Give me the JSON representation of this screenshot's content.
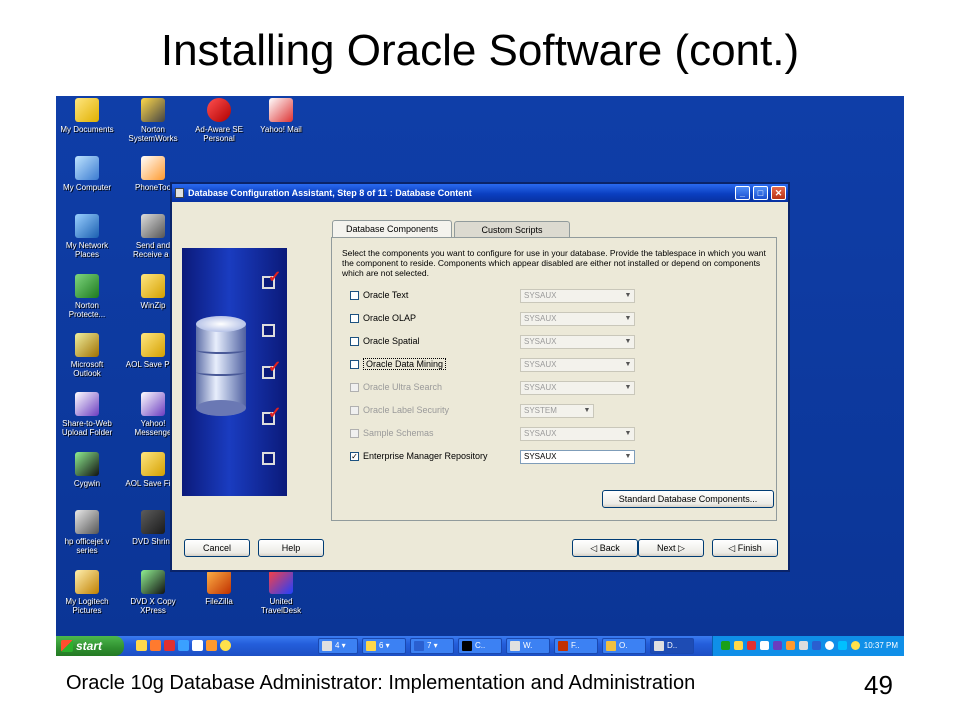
{
  "slide": {
    "title": "Installing Oracle Software (cont.)",
    "footer": "Oracle 10g Database Administrator: Implementation and Administration",
    "page_number": "49"
  },
  "desktop_icons": [
    {
      "label": "My Documents",
      "icon": "my-documents-icon"
    },
    {
      "label": "Norton SystemWorks",
      "icon": "norton-systemworks-icon"
    },
    {
      "label": "Ad-Aware SE Personal",
      "icon": "ad-aware-icon"
    },
    {
      "label": "Yahoo! Mail",
      "icon": "yahoo-mail-icon"
    },
    {
      "label": "My Computer",
      "icon": "my-computer-icon"
    },
    {
      "label": "PhoneToo",
      "icon": "phonetools-icon"
    },
    {
      "label": "My Network Places",
      "icon": "network-places-icon"
    },
    {
      "label": "Send and Receive a f",
      "icon": "send-receive-icon"
    },
    {
      "label": "Norton Protecte...",
      "icon": "norton-protected-icon"
    },
    {
      "label": "WinZip",
      "icon": "winzip-icon"
    },
    {
      "label": "Microsoft Outlook",
      "icon": "outlook-icon"
    },
    {
      "label": "AOL Save PFC",
      "icon": "folder-icon"
    },
    {
      "label": "Share-to-Web Upload Folder",
      "icon": "share-to-web-icon"
    },
    {
      "label": "Yahoo! Messenge",
      "icon": "yahoo-messenger-icon"
    },
    {
      "label": "Cygwin",
      "icon": "cygwin-icon"
    },
    {
      "label": "AOL Save Files",
      "icon": "folder-icon"
    },
    {
      "label": "hp officejet v series",
      "icon": "printer-icon"
    },
    {
      "label": "DVD Shrink",
      "icon": "dvd-shrink-icon"
    },
    {
      "label": "My Logitech Pictures",
      "icon": "logitech-pictures-icon"
    },
    {
      "label": "DVD X Copy XPress",
      "icon": "dvd-x-copy-icon"
    },
    {
      "label": "FileZilla",
      "icon": "filezilla-icon"
    },
    {
      "label": "United TravelDesk",
      "icon": "united-traveldesk-icon"
    }
  ],
  "dialog": {
    "title": "Database Configuration Assistant, Step 8 of 11 : Database Content",
    "controls": {
      "minimize": "_",
      "maximize": "□",
      "close": "✕"
    },
    "tabs": [
      {
        "label": "Database Components",
        "active": true
      },
      {
        "label": "Custom Scripts",
        "active": false
      }
    ],
    "description": "Select the components you want to configure for use in your database. Provide the tablespace in which you want the component to reside. Components which appear disabled are either not installed or depend on components which are not selected.",
    "components": [
      {
        "label": "Oracle Text",
        "checked": false,
        "enabled": true,
        "tablespace": "SYSAUX",
        "tablespace_enabled": false
      },
      {
        "label": "Oracle OLAP",
        "checked": false,
        "enabled": true,
        "tablespace": "SYSAUX",
        "tablespace_enabled": false
      },
      {
        "label": "Oracle Spatial",
        "checked": false,
        "enabled": true,
        "tablespace": "SYSAUX",
        "tablespace_enabled": false
      },
      {
        "label": "Oracle Data Mining",
        "checked": false,
        "enabled": true,
        "tablespace": "SYSAUX",
        "tablespace_enabled": false
      },
      {
        "label": "Oracle Ultra Search",
        "checked": false,
        "enabled": false,
        "tablespace": "SYSAUX",
        "tablespace_enabled": false
      },
      {
        "label": "Oracle Label Security",
        "checked": false,
        "enabled": false,
        "tablespace": "SYSTEM",
        "tablespace_enabled": false
      },
      {
        "label": "Sample Schemas",
        "checked": false,
        "enabled": false,
        "tablespace": "SYSAUX",
        "tablespace_enabled": false
      },
      {
        "label": "Enterprise Manager Repository",
        "checked": true,
        "enabled": true,
        "tablespace": "SYSAUX",
        "tablespace_enabled": true
      }
    ],
    "standard_components_button": "Standard Database Components...",
    "buttons": {
      "cancel": "Cancel",
      "help": "Help",
      "back": "Back",
      "next": "Next",
      "finish": "Finish"
    }
  },
  "taskbar": {
    "start_label": "start",
    "tasks": [
      {
        "label": "4",
        "icon": "ie-icon"
      },
      {
        "label": "6",
        "icon": "folder-icon"
      },
      {
        "label": "7",
        "icon": "word-icon"
      },
      {
        "label": "C..",
        "icon": "cmd-icon"
      },
      {
        "label": "W.",
        "icon": "window-icon"
      },
      {
        "label": "F..",
        "icon": "filezilla-icon"
      },
      {
        "label": "O.",
        "icon": "outlook-icon"
      },
      {
        "label": "D..",
        "icon": "dbca-icon"
      }
    ],
    "clock": "10:37 PM"
  },
  "colors": {
    "desktop": "#0f3ea8",
    "titlebar": "#0a3fc0",
    "dialog_bg": "#ece9d8",
    "check_mark": "#e02020"
  }
}
